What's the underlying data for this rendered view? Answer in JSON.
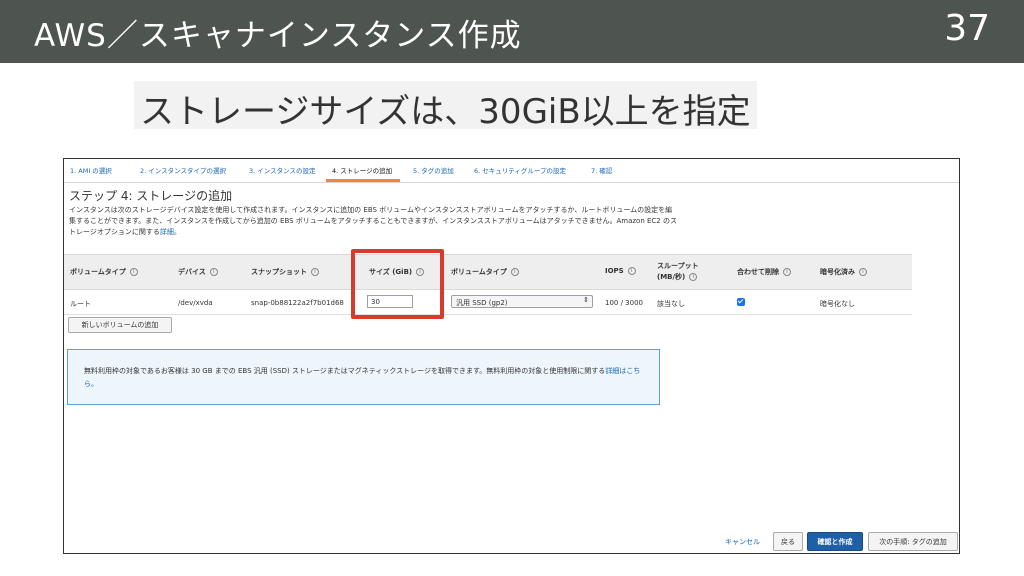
{
  "slide": {
    "title": "AWS／スキャナインスタンス作成",
    "number": "37",
    "subtitle": "ストレージサイズは、30GiB以上を指定"
  },
  "wizard": {
    "tabs": [
      {
        "label": "1. AMI の選択"
      },
      {
        "label": "2. インスタンスタイプの選択"
      },
      {
        "label": "3. インスタンスの設定"
      },
      {
        "label": "4. ストレージの追加",
        "active": true
      },
      {
        "label": "5. タグの追加"
      },
      {
        "label": "6. セキュリティグループの設定"
      },
      {
        "label": "7. 確認"
      }
    ],
    "accent_color": "#f58536"
  },
  "step": {
    "title": "ステップ 4: ストレージの追加",
    "description": "インスタンスは次のストレージデバイス設定を使用して作成されます。インスタンスに追加の EBS ボリュームやインスタンスストアボリュームをアタッチするか、ルートボリュームの設定を編集することができます。また、インスタンスを作成してから追加の EBS ボリュームをアタッチすることもできますが、インスタンスストアボリュームはアタッチできません。Amazon EC2 のストレージオプションに関する",
    "description_link": "詳細。"
  },
  "table": {
    "headers": {
      "volume_type": "ボリュームタイプ",
      "device": "デバイス",
      "snapshot": "スナップショット",
      "size": "サイズ (GiB)",
      "volume_kind": "ボリュームタイプ",
      "iops": "IOPS",
      "throughput_line1": "スループット",
      "throughput_line2": "(MB/秒)",
      "delete_on_termination": "合わせて削除",
      "encryption": "暗号化済み"
    },
    "info_glyph": "i",
    "row": {
      "volume_type": "ルート",
      "device": "/dev/xvda",
      "snapshot": "snap-0b88122a2f7b01d68",
      "size": "30",
      "volume_kind": "汎用 SSD (gp2)",
      "iops": "100 / 3000",
      "throughput": "該当なし",
      "delete_on_termination": true,
      "encryption": "暗号化なし"
    }
  },
  "add_volume_button": "新しいボリュームの追加",
  "info_box": {
    "text": "無料利用枠の対象であるお客様は 30 GB までの EBS 汎用 (SSD) ストレージまたはマグネティックストレージを取得できます。無料利用枠の対象と使用制限に関する",
    "link": "詳細はこちら。"
  },
  "footer": {
    "cancel": "キャンセル",
    "back": "戻る",
    "review_launch": "確認と作成",
    "next": "次の手順: タグの追加"
  },
  "colors": {
    "header_bg": "#4e5450",
    "highlight_border": "#d63b2e",
    "primary_button": "#1f5fa8",
    "link": "#1a66b5"
  }
}
